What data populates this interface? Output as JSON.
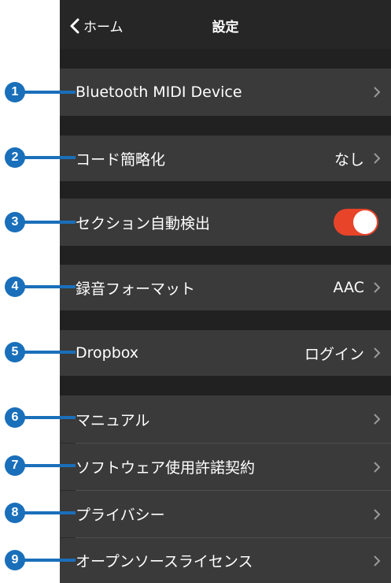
{
  "nav": {
    "back_label": "ホーム",
    "title": "設定"
  },
  "rows": [
    {
      "label": "Bluetooth MIDI Device",
      "value": ""
    },
    {
      "label": "コード簡略化",
      "value": "なし"
    },
    {
      "label": "セクション自動検出",
      "value": ""
    },
    {
      "label": "録音フォーマット",
      "value": "AAC"
    },
    {
      "label": "Dropbox",
      "value": "ログイン"
    },
    {
      "label": "マニュアル",
      "value": ""
    },
    {
      "label": "ソフトウェア使用許諾契約",
      "value": ""
    },
    {
      "label": "プライバシー",
      "value": ""
    },
    {
      "label": "オープンソースライセンス",
      "value": ""
    }
  ],
  "toggle_on": true,
  "callouts": [
    "1",
    "2",
    "3",
    "4",
    "5",
    "6",
    "7",
    "8",
    "9"
  ],
  "colors": {
    "callout": "#1a6fba",
    "toggle_on": "#e8442a"
  }
}
